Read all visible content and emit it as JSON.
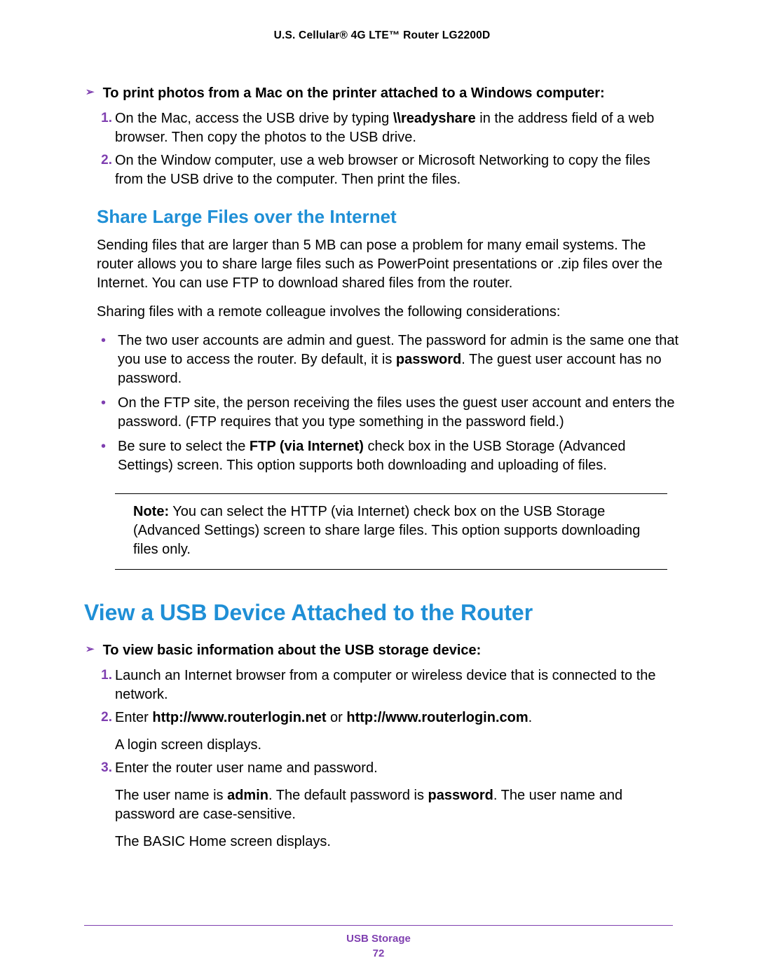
{
  "header": {
    "title": "U.S. Cellular® 4G LTE™ Router LG2200D"
  },
  "section1": {
    "proc_title": "To print photos from a Mac on the printer attached to a Windows computer:",
    "steps": [
      {
        "num": "1.",
        "pre": "On the Mac, access the USB drive by typing ",
        "bold": "\\\\readyshare",
        "post": " in the address field of a web browser. Then copy the photos to the USB drive."
      },
      {
        "num": "2.",
        "pre": "On the Window computer, use a web browser or Microsoft Networking to copy the files from the USB drive to the computer. Then print the files.",
        "bold": "",
        "post": ""
      }
    ]
  },
  "h2": {
    "text": "Share Large Files over the Internet"
  },
  "para1": "Sending files that are larger than 5 MB can pose a problem for many email systems. The router allows you to share large files such as PowerPoint presentations or .zip files over the Internet. You can use FTP to download shared files from the router.",
  "para2": "Sharing files with a remote colleague involves the following considerations:",
  "bullets": [
    {
      "pre": "The two user accounts are admin and guest. The password for admin is the same one that you use to access the router. By default, it is ",
      "bold": "password",
      "post": ". The guest user account has no password."
    },
    {
      "pre": "On the FTP site, the person receiving the files uses the guest user account and enters the password. (FTP requires that you type something in the password field.)",
      "bold": "",
      "post": ""
    },
    {
      "pre": "Be sure to select the ",
      "bold": "FTP (via Internet)",
      "post": " check box in the USB Storage (Advanced Settings) screen. This option supports both downloading and uploading of files."
    }
  ],
  "note": {
    "label": "Note:",
    "text": " You can select the HTTP (via Internet) check box on the USB Storage (Advanced Settings) screen to share large files. This option supports downloading files only."
  },
  "h1": {
    "text": "View a USB Device Attached to the Router"
  },
  "section2": {
    "proc_title": "To view basic information about the USB storage device:",
    "steps": {
      "s1": {
        "num": "1.",
        "text": "Launch an Internet browser from a computer or wireless device that is connected to the network."
      },
      "s2": {
        "num": "2.",
        "pre": "Enter ",
        "b1": "http://www.routerlogin.net",
        "mid": " or ",
        "b2": "http://www.routerlogin.com",
        "post": ".",
        "after": "A login screen displays."
      },
      "s3": {
        "num": "3.",
        "text": "Enter the router user name and password.",
        "p2_pre": "The user name is ",
        "p2_b1": "admin",
        "p2_mid": ". The default password is ",
        "p2_b2": "password",
        "p2_post": ". The user name and password are case-sensitive.",
        "p3": "The BASIC Home screen displays."
      }
    }
  },
  "footer": {
    "section": "USB Storage",
    "page": "72"
  },
  "icons": {
    "arrow": "➢"
  }
}
